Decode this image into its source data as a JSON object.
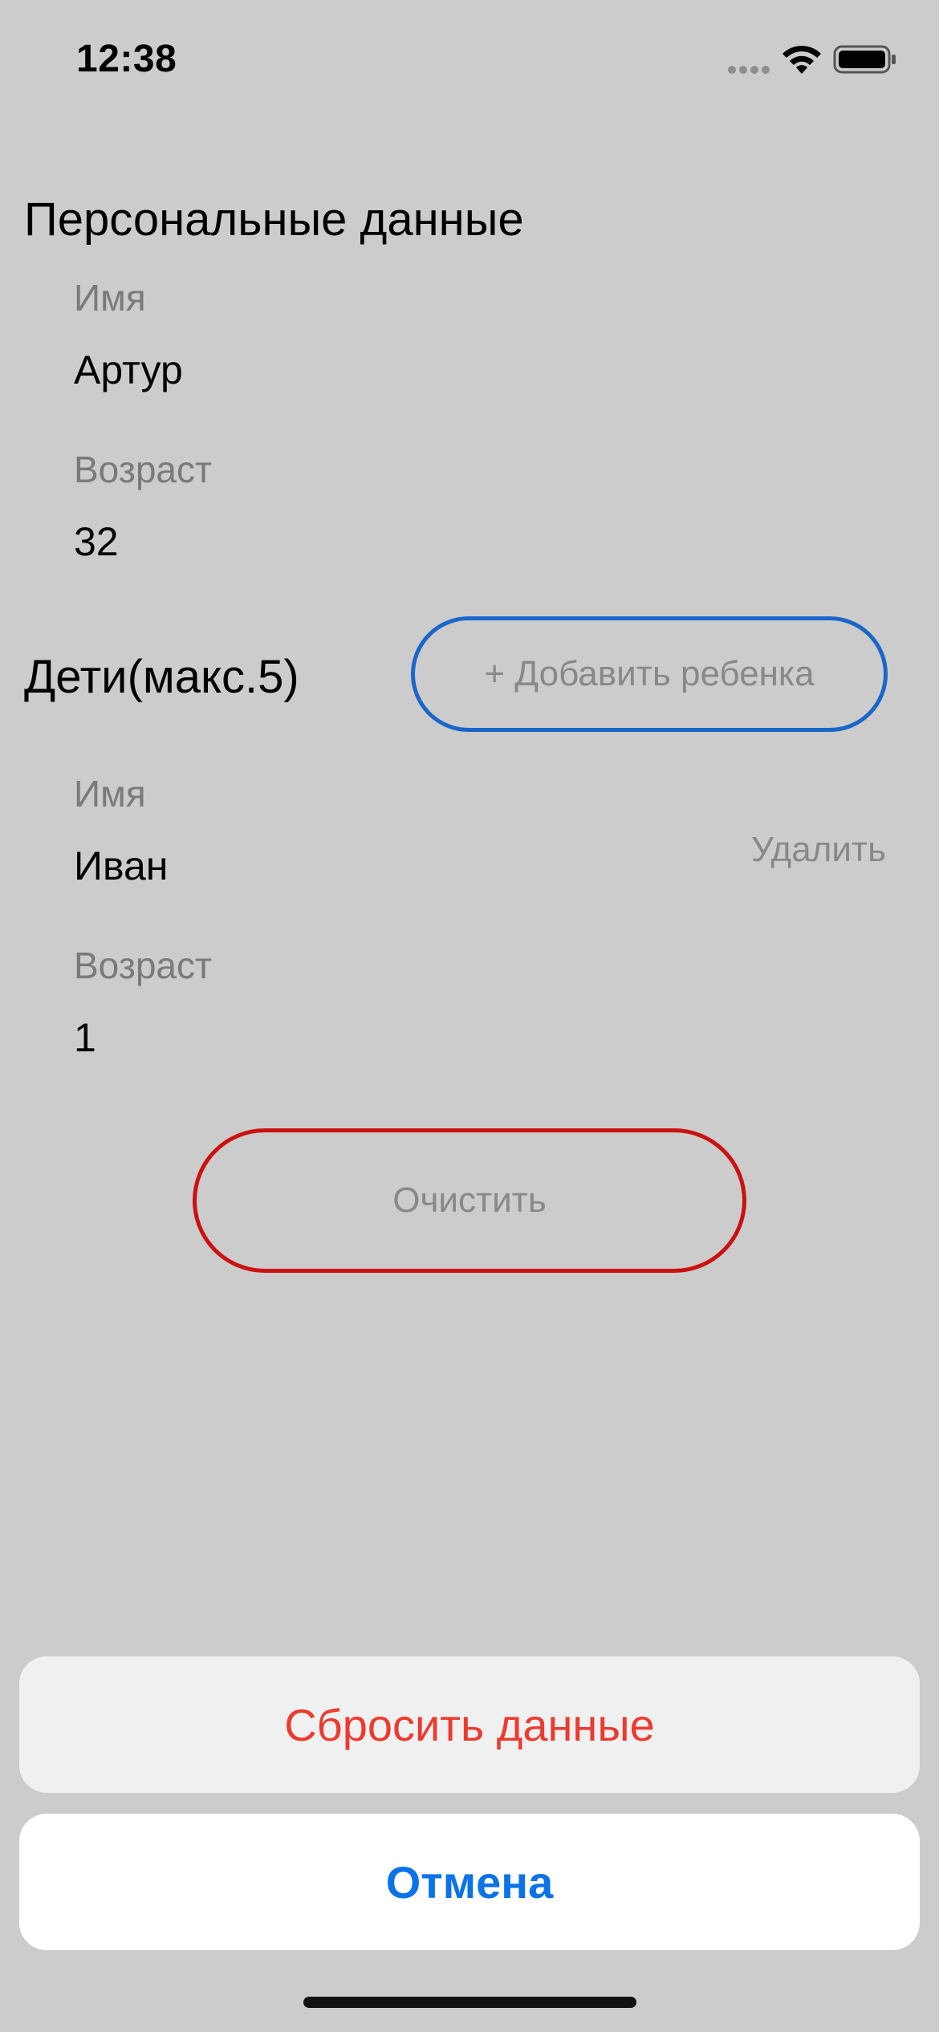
{
  "status_bar": {
    "time": "12:38",
    "icons": [
      "cellular-signal-icon",
      "wifi-icon",
      "battery-icon"
    ]
  },
  "personal": {
    "title": "Персональные данные",
    "name_label": "Имя",
    "name_value": "Артур",
    "age_label": "Возраст",
    "age_value": "32"
  },
  "children": {
    "title": "Дети(макс.5)",
    "add_button": "+ Добавить ребенка",
    "items": [
      {
        "name_label": "Имя",
        "name_value": "Иван",
        "age_label": "Возраст",
        "age_value": "1",
        "delete_label": "Удалить"
      }
    ]
  },
  "clear_button": "Очистить",
  "action_sheet": {
    "reset_label": "Сбросить данные",
    "cancel_label": "Отмена"
  },
  "colors": {
    "background": "#cccccc",
    "add_button_border": "#1a66c9",
    "clear_button_border": "#cc1111",
    "destructive": "#eb3b30",
    "accent": "#0b72e8"
  }
}
